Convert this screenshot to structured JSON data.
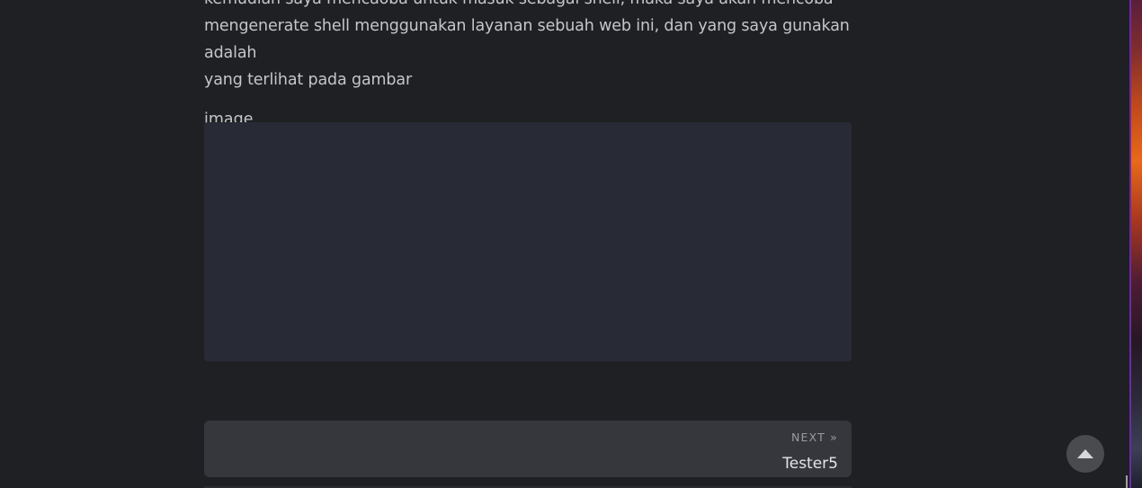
{
  "article": {
    "paragraph_lines": [
      "kemudian saya mencaoba untuk masuk sebagai shell, maka saya akan mencoba",
      "mengenerate shell menggunakan layanan sebuah web ini, dan yang saya gunakan adalah",
      "yang terlihat pada gambar"
    ],
    "image_alt": "image"
  },
  "post_nav": {
    "label": "NEXT »",
    "title": "Tester5"
  },
  "back_to_top": {
    "icon": "chevron-up-icon"
  },
  "colors": {
    "background": "#1f2023",
    "code_block": "#282a36",
    "nav_card": "#36373c",
    "text": "#c6c6c9"
  }
}
